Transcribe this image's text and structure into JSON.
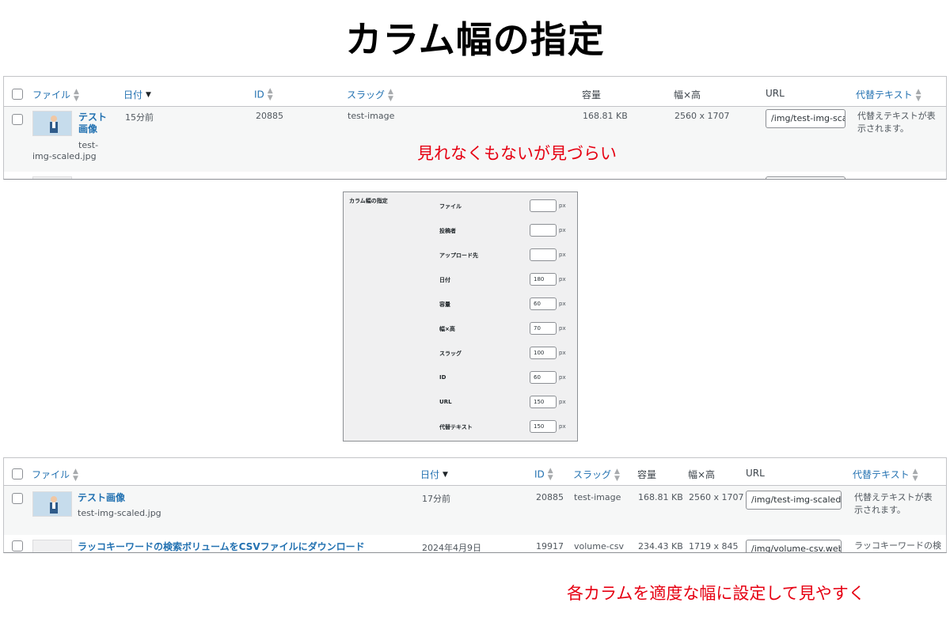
{
  "title": "カラム幅の指定",
  "panel1": {
    "headers": {
      "file": "ファイル",
      "date": "日付",
      "id": "ID",
      "slug": "スラッグ",
      "size": "容量",
      "dim": "幅×高",
      "url": "URL",
      "alt": "代替テキスト"
    },
    "row": {
      "title_line1": "テスト",
      "title_line2": "画像",
      "filename_line1": "test-",
      "filename_line2": "img-scaled.jpg",
      "date": "15分前",
      "id": "20885",
      "slug": "test-image",
      "size": "168.81 KB",
      "dim": "2560 x 1707",
      "url": "/img/test-img-sca",
      "alt_line1": "代替えテキストが表",
      "alt_line2": "示されます。"
    }
  },
  "note_top": "見れなくもないが見づらい",
  "settings": {
    "title": "カラム幅の指定",
    "unit": "px",
    "fields": [
      {
        "label": "ファイル",
        "value": ""
      },
      {
        "label": "投稿者",
        "value": ""
      },
      {
        "label": "アップロード先",
        "value": ""
      },
      {
        "label": "日付",
        "value": "180"
      },
      {
        "label": "容量",
        "value": "60"
      },
      {
        "label": "幅×高",
        "value": "70"
      },
      {
        "label": "スラッグ",
        "value": "100"
      },
      {
        "label": "ID",
        "value": "60"
      },
      {
        "label": "URL",
        "value": "150"
      },
      {
        "label": "代替テキスト",
        "value": "150"
      }
    ]
  },
  "panel2": {
    "headers": {
      "file": "ファイル",
      "date": "日付",
      "id": "ID",
      "slug": "スラッグ",
      "size": "容量",
      "dim": "幅×高",
      "url": "URL",
      "alt": "代替テキスト"
    },
    "rows": [
      {
        "title": "テスト画像",
        "filename": "test-img-scaled.jpg",
        "date": "17分前",
        "id": "20885",
        "slug": "test-image",
        "size": "168.81 KB",
        "dim": "2560 x 1707",
        "url": "/img/test-img-scaled",
        "alt_line1": "代替えテキストが表",
        "alt_line2": "示されます。"
      },
      {
        "title": "ラッコキーワードの検索ボリュームをCSVファイルにダウンロード",
        "date": "2024年4月9日",
        "id": "19917",
        "slug": "volume-csv",
        "size": "234.43 KB",
        "dim": "1719 x 845",
        "url": "/img/volume-csv.web",
        "alt_line1": "ラッコキーワードの検"
      }
    ]
  },
  "note_bottom": "各カラムを適度な幅に設定して見やすく",
  "colors": {
    "link": "#2271b1",
    "note": "#e60012",
    "row_alt": "#f6f7f7"
  }
}
